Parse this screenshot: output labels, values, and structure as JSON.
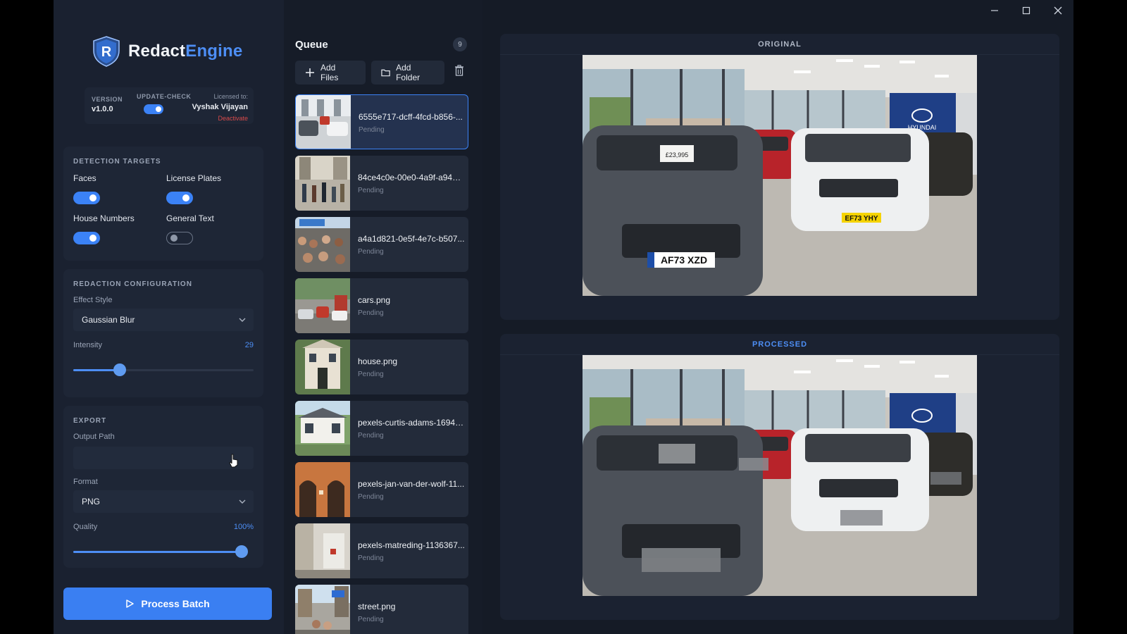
{
  "app": {
    "name_part1": "Redact",
    "name_part2": "Engine",
    "accent": "#3b82f6"
  },
  "window_controls": {
    "minimize": "minimize-icon",
    "maximize": "maximize-icon",
    "close": "close-icon"
  },
  "info": {
    "version_label": "VERSION",
    "version_value": "v1.0.0",
    "update_label": "UPDATE-CHECK",
    "update_on": true,
    "licensed_label": "Licensed to:",
    "licensed_name": "Vyshak Vijayan",
    "deactivate": "Deactivate"
  },
  "detection": {
    "title": "DETECTION TARGETS",
    "faces": {
      "label": "Faces",
      "on": true
    },
    "plates": {
      "label": "License Plates",
      "on": true
    },
    "house": {
      "label": "House Numbers",
      "on": true
    },
    "text": {
      "label": "General Text",
      "on": false
    }
  },
  "redaction": {
    "title": "REDACTION CONFIGURATION",
    "effect_label": "Effect Style",
    "effect_value": "Gaussian Blur",
    "intensity_label": "Intensity",
    "intensity_value": "29",
    "intensity_fraction": 0.29
  },
  "export": {
    "title": "EXPORT",
    "output_label": "Output Path",
    "output_value": "",
    "format_label": "Format",
    "format_value": "PNG",
    "quality_label": "Quality",
    "quality_value": "100%",
    "quality_fraction": 1.0
  },
  "process_button": "Process Batch",
  "queue": {
    "title": "Queue",
    "count": "9",
    "add_files": "Add Files",
    "add_folder": "Add Folder",
    "items": [
      {
        "name": "6555e717-dcff-4fcd-b856-...",
        "status": "Pending"
      },
      {
        "name": "84ce4c0e-00e0-4a9f-a94d-...",
        "status": "Pending"
      },
      {
        "name": "a4a1d821-0e5f-4e7c-b507...",
        "status": "Pending"
      },
      {
        "name": "cars.png",
        "status": "Pending"
      },
      {
        "name": "house.png",
        "status": "Pending"
      },
      {
        "name": "pexels-curtis-adams-16940...",
        "status": "Pending"
      },
      {
        "name": "pexels-jan-van-der-wolf-11...",
        "status": "Pending"
      },
      {
        "name": "pexels-matreding-1136367...",
        "status": "Pending"
      },
      {
        "name": "street.png",
        "status": "Pending"
      }
    ]
  },
  "preview": {
    "original_label": "ORIGINAL",
    "processed_label": "PROCESSED",
    "plates": [
      "AF73 XZD",
      "EF73 YHY",
      "£23,995"
    ],
    "brand_sign": "HYUNDAI"
  }
}
